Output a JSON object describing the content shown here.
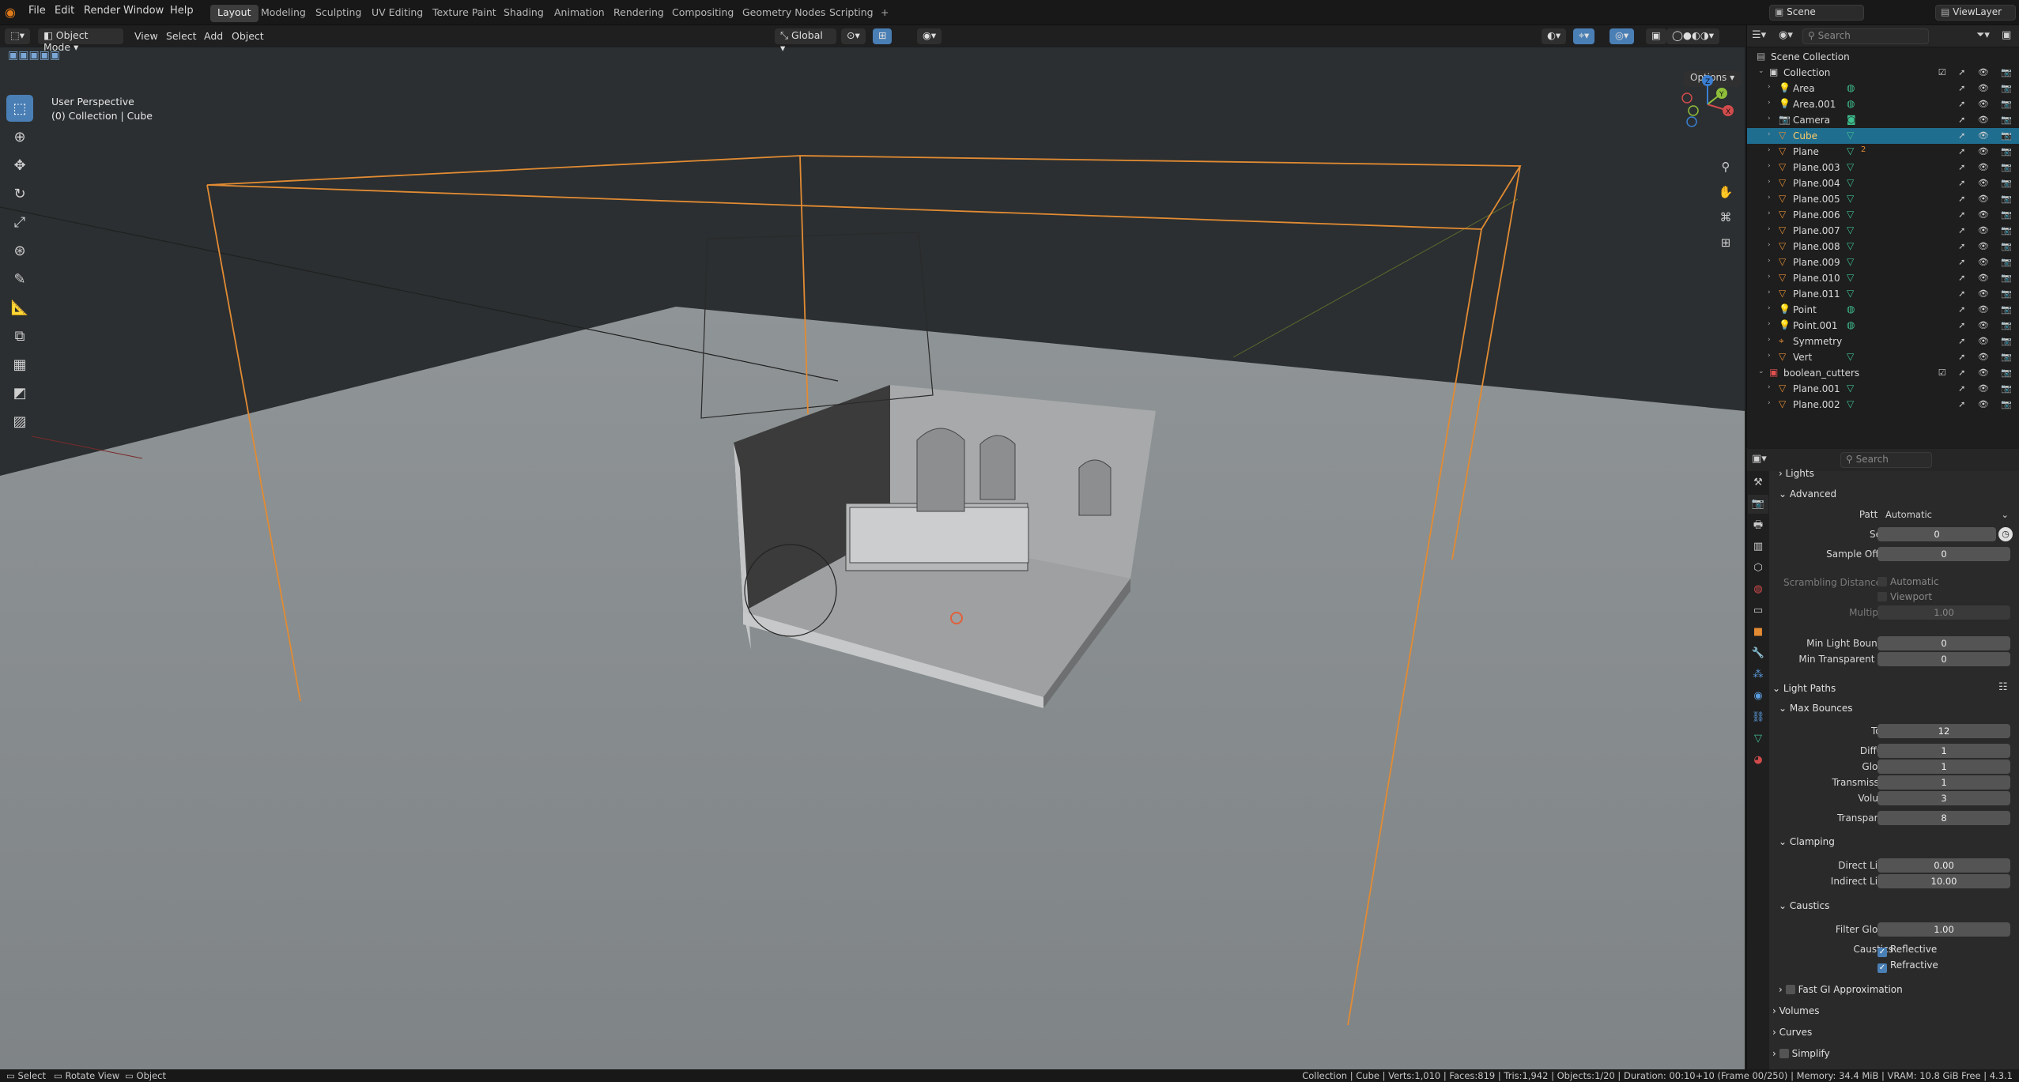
{
  "menu": {
    "file": "File",
    "edit": "Edit",
    "render": "Render",
    "window": "Window",
    "help": "Help"
  },
  "workspaces": [
    "Layout",
    "Modeling",
    "Sculpting",
    "UV Editing",
    "Texture Paint",
    "Shading",
    "Animation",
    "Rendering",
    "Compositing",
    "Geometry Nodes",
    "Scripting"
  ],
  "add_workspace": "+",
  "scene": "Scene",
  "viewlayer": "ViewLayer",
  "viewport": {
    "mode": "Object Mode",
    "view": "View",
    "select": "Select",
    "add": "Add",
    "object": "Object",
    "orientation": "Global",
    "options": "Options",
    "info1": "User Perspective",
    "info2": "(0) Collection | Cube",
    "axis_x": "X",
    "axis_y": "Y",
    "axis_z": "Z"
  },
  "outliner": {
    "search_placeholder": "Search",
    "root": "Scene Collection",
    "items": [
      {
        "name": "Collection",
        "level": 0,
        "type": "coll",
        "open": true
      },
      {
        "name": "Area",
        "level": 1,
        "type": "light"
      },
      {
        "name": "Area.001",
        "level": 1,
        "type": "light"
      },
      {
        "name": "Camera",
        "level": 1,
        "type": "camera"
      },
      {
        "name": "Cube",
        "level": 1,
        "type": "mesh",
        "selected": true
      },
      {
        "name": "Plane",
        "level": 1,
        "type": "mesh",
        "extra": "2"
      },
      {
        "name": "Plane.003",
        "level": 1,
        "type": "mesh"
      },
      {
        "name": "Plane.004",
        "level": 1,
        "type": "mesh"
      },
      {
        "name": "Plane.005",
        "level": 1,
        "type": "mesh"
      },
      {
        "name": "Plane.006",
        "level": 1,
        "type": "mesh"
      },
      {
        "name": "Plane.007",
        "level": 1,
        "type": "mesh"
      },
      {
        "name": "Plane.008",
        "level": 1,
        "type": "mesh"
      },
      {
        "name": "Plane.009",
        "level": 1,
        "type": "mesh"
      },
      {
        "name": "Plane.010",
        "level": 1,
        "type": "mesh"
      },
      {
        "name": "Plane.011",
        "level": 1,
        "type": "mesh"
      },
      {
        "name": "Point",
        "level": 1,
        "type": "light"
      },
      {
        "name": "Point.001",
        "level": 1,
        "type": "light"
      },
      {
        "name": "Symmetry",
        "level": 1,
        "type": "empty"
      },
      {
        "name": "Vert",
        "level": 1,
        "type": "mesh"
      },
      {
        "name": "boolean_cutters",
        "level": 0,
        "type": "coll2",
        "open": true
      },
      {
        "name": "Plane.001",
        "level": 1,
        "type": "mesh"
      },
      {
        "name": "Plane.002",
        "level": 1,
        "type": "mesh"
      }
    ]
  },
  "props": {
    "search_placeholder": "Search",
    "lights": "Lights",
    "advanced": "Advanced",
    "pattern_label": "Pattern",
    "pattern_value": "Automatic",
    "seed_label": "Seed",
    "seed_value": "0",
    "sample_offset_label": "Sample Offset",
    "sample_offset_value": "0",
    "scrambling_label": "Scrambling Distance",
    "automatic": "Automatic",
    "viewport": "Viewport",
    "multiplier_label": "Multiplier",
    "multiplier_value": "1.00",
    "min_light_label": "Min Light Bounces",
    "min_light_value": "0",
    "min_trans_label": "Min Transparent B...",
    "min_trans_value": "0",
    "light_paths": "Light Paths",
    "max_bounces": "Max Bounces",
    "total_label": "Total",
    "total_value": "12",
    "diffuse_label": "Diffuse",
    "diffuse_value": "1",
    "glossy_label": "Glossy",
    "glossy_value": "1",
    "transmission_label": "Transmission",
    "transmission_value": "1",
    "volume_label": "Volume",
    "volume_value": "3",
    "transparent_label": "Transparent",
    "transparent_value": "8",
    "clamping": "Clamping",
    "direct_label": "Direct Light",
    "direct_value": "0.00",
    "indirect_label": "Indirect Light",
    "indirect_value": "10.00",
    "caustics": "Caustics",
    "filter_glossy_label": "Filter Glossy",
    "filter_glossy_value": "1.00",
    "caustics_label": "Caustics",
    "reflective": "Reflective",
    "refractive": "Refractive",
    "fast_gi": "Fast GI Approximation",
    "volumes": "Volumes",
    "curves": "Curves",
    "simplify": "Simplify"
  },
  "status": {
    "select": "Select",
    "rotate": "Rotate View",
    "object": "Object",
    "stats": "Collection | Cube | Verts:1,010 | Faces:819 | Tris:1,942 | Objects:1/20 | Duration: 00:10+10 (Frame 00/250) | Memory: 34.4 MiB | VRAM: 10.8 GiB Free | 4.3.1"
  }
}
